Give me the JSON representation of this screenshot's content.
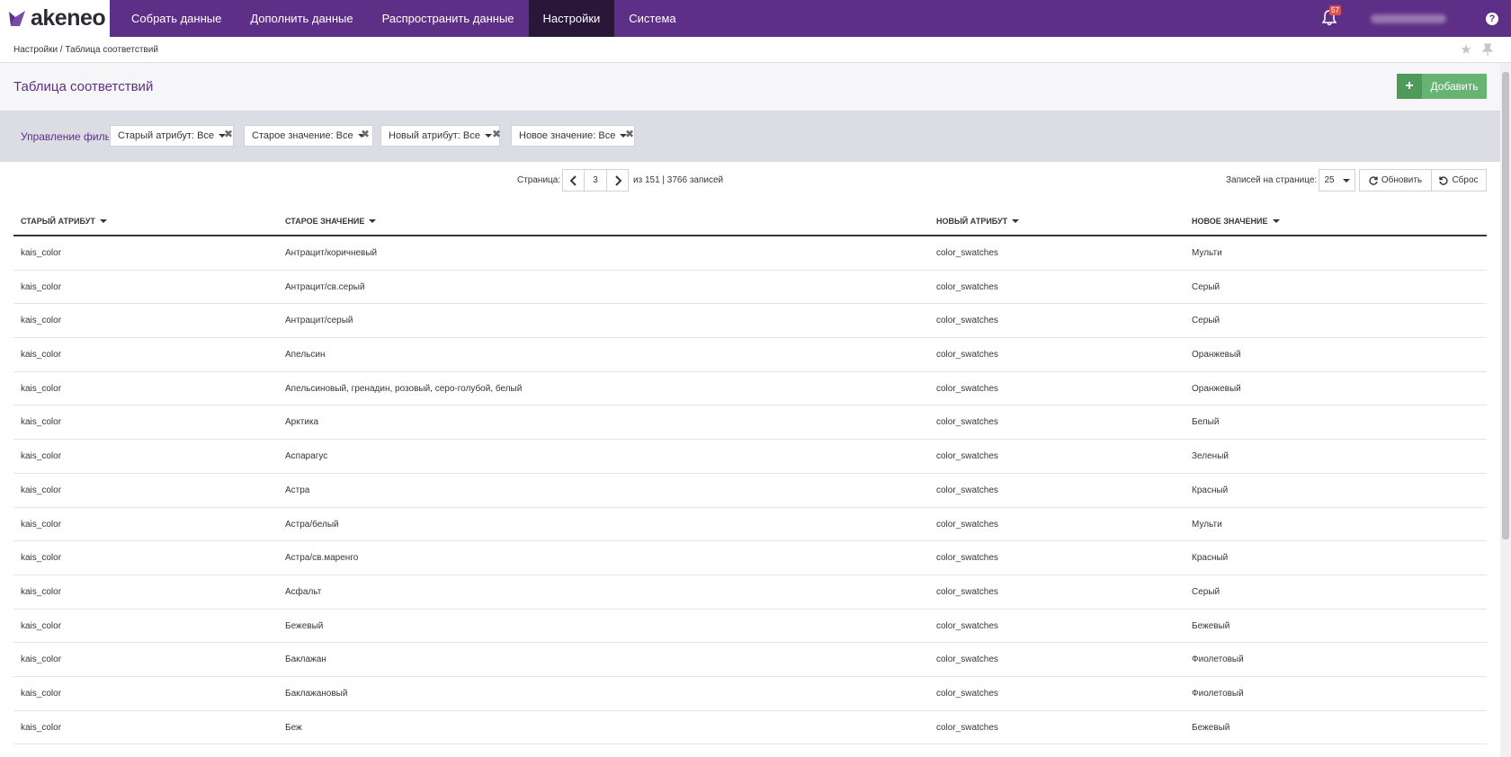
{
  "app": {
    "logo_text": "akeneo"
  },
  "nav": {
    "items": [
      {
        "label": "Собрать данные"
      },
      {
        "label": "Дополнить данные"
      },
      {
        "label": "Распространить данные"
      },
      {
        "label": "Настройки",
        "active": true
      },
      {
        "label": "Система"
      }
    ]
  },
  "topright": {
    "notifications_count": "57",
    "help_label": "?"
  },
  "breadcrumb": {
    "text": "Настройки / Таблица соответствий"
  },
  "page": {
    "title": "Таблица соответствий",
    "add_label": "Добавить",
    "add_icon": "+"
  },
  "filters": {
    "label": "Управление фильтрами",
    "items": [
      {
        "label": "Старый атрибут: Все"
      },
      {
        "label": "Старое значение: Все"
      },
      {
        "label": "Новый атрибут: Все"
      },
      {
        "label": "Новое значение: Все"
      }
    ],
    "close_glyph": "✖"
  },
  "pagination": {
    "label": "Страница:",
    "current_page": "3",
    "info": "из 151 | 3766 записей",
    "per_page_label": "Записей на странице:",
    "per_page_value": "25",
    "refresh_label": "Обновить",
    "reset_label": "Сброс"
  },
  "table": {
    "columns": [
      "Старый атрибут",
      "Старое значение",
      "Новый атрибут",
      "Новое значение"
    ],
    "rows": [
      [
        "kais_color",
        "Антрацит/коричневый",
        "color_swatches",
        "Мульти"
      ],
      [
        "kais_color",
        "Антрацит/св.серый",
        "color_swatches",
        "Серый"
      ],
      [
        "kais_color",
        "Антрацит/серый",
        "color_swatches",
        "Серый"
      ],
      [
        "kais_color",
        "Апельсин",
        "color_swatches",
        "Оранжевый"
      ],
      [
        "kais_color",
        "Апельсиновый, гренадин, розовый, серо-голубой, белый",
        "color_swatches",
        "Оранжевый"
      ],
      [
        "kais_color",
        "Арктика",
        "color_swatches",
        "Белый"
      ],
      [
        "kais_color",
        "Аспарагус",
        "color_swatches",
        "Зеленый"
      ],
      [
        "kais_color",
        "Астра",
        "color_swatches",
        "Красный"
      ],
      [
        "kais_color",
        "Астра/белый",
        "color_swatches",
        "Мульти"
      ],
      [
        "kais_color",
        "Астра/св.маренго",
        "color_swatches",
        "Красный"
      ],
      [
        "kais_color",
        "Асфальт",
        "color_swatches",
        "Серый"
      ],
      [
        "kais_color",
        "Бежевый",
        "color_swatches",
        "Бежевый"
      ],
      [
        "kais_color",
        "Баклажан",
        "color_swatches",
        "Фиолетовый"
      ],
      [
        "kais_color",
        "Баклажановый",
        "color_swatches",
        "Фиолетовый"
      ],
      [
        "kais_color",
        "Беж",
        "color_swatches",
        "Бежевый"
      ]
    ]
  },
  "colors": {
    "brand": "#5d2f86",
    "nav_active": "#2a1638",
    "add_button": "#67b373"
  }
}
